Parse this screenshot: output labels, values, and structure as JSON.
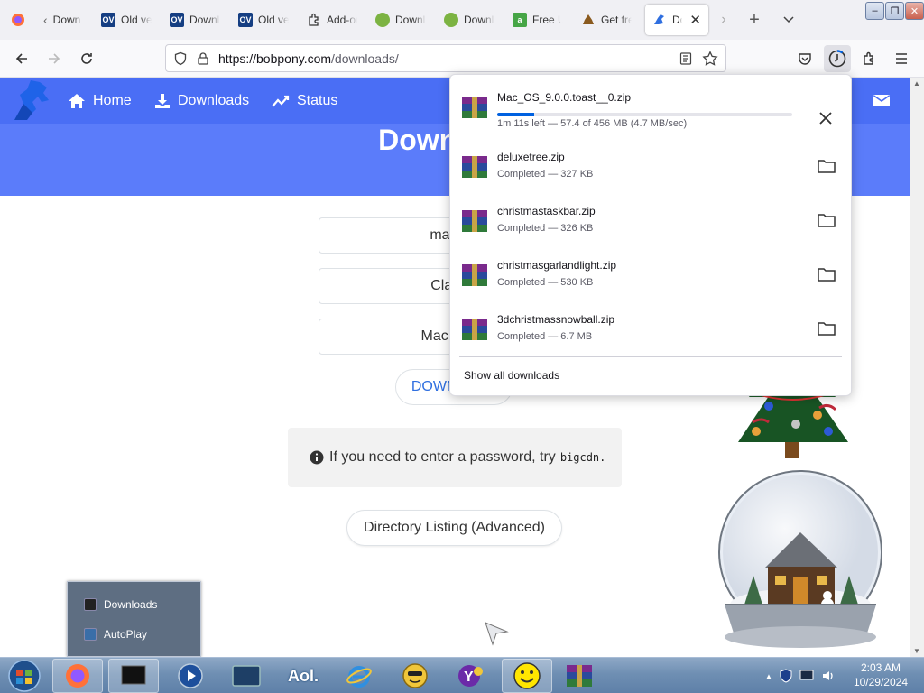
{
  "tabs": [
    {
      "title": "Down",
      "fav": "firefox-icon"
    },
    {
      "title": "Old versions",
      "fav": "ov"
    },
    {
      "title": "Downloads",
      "fav": "ov"
    },
    {
      "title": "Old versions",
      "fav": "ov"
    },
    {
      "title": "Add-ons",
      "fav": "puzzle-icon"
    },
    {
      "title": "Downloads",
      "fav": "frog-icon"
    },
    {
      "title": "Downloads",
      "fav": "frog-icon"
    },
    {
      "title": "Free Up",
      "fav": "a"
    },
    {
      "title": "Get free",
      "fav": "poop-icon"
    },
    {
      "title": "Downloads",
      "fav": "pony-icon"
    }
  ],
  "url": {
    "host": "https://bobpony.com",
    "path": "/downloads/"
  },
  "site": {
    "nav": [
      {
        "label": "Home",
        "icon": "home-icon"
      },
      {
        "label": "Downloads",
        "icon": "download-icon"
      },
      {
        "label": "Status",
        "icon": "chart-line-icon"
      }
    ],
    "heading": "Downloads",
    "buttons": [
      "macOS",
      "Classic",
      "Mac OS X"
    ],
    "download_label": "DOWNLOAD",
    "info_text": "If you need to enter a password, try",
    "info_code": "bigcdn.",
    "directory_button": "Directory Listing (Advanced)"
  },
  "downloads": {
    "active": {
      "name": "Mac_OS_9.0.0.toast__0.zip",
      "status": "1m 11s left — 57.4 of 456 MB (4.7 MB/sec)",
      "progress": 0.126
    },
    "completed": [
      {
        "name": "deluxetree.zip",
        "status": "Completed — 327 KB"
      },
      {
        "name": "christmastaskbar.zip",
        "status": "Completed — 326 KB"
      },
      {
        "name": "christmasgarlandlight.zip",
        "status": "Completed — 530 KB"
      },
      {
        "name": "3dchristmassnowball.zip",
        "status": "Completed — 6.7 MB"
      }
    ],
    "show_all": "Show all downloads"
  },
  "tray_popup": [
    {
      "label": "Downloads"
    },
    {
      "label": "AutoPlay"
    }
  ],
  "taskbar": {
    "time": "2:03 AM",
    "date": "10/29/2024"
  },
  "colors": {
    "accent": "#4a6ef5",
    "progress": "#0061e0"
  }
}
